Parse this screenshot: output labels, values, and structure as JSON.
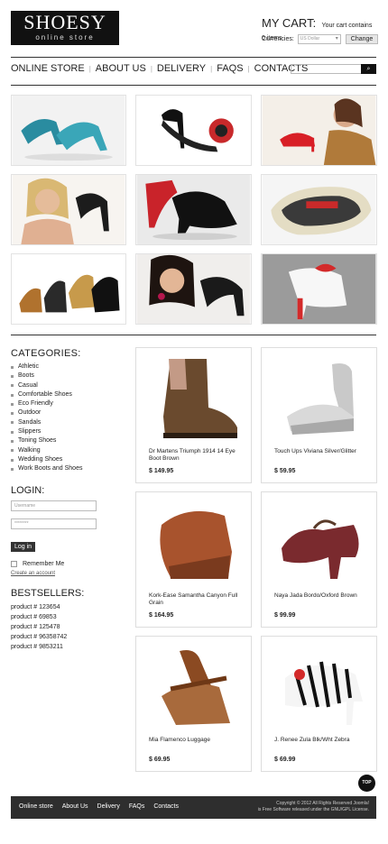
{
  "header": {
    "logo_title": "SHOESY",
    "logo_subtitle": "online store",
    "cart_title": "MY CART:",
    "cart_status": "Your cart contains 0 items",
    "currencies_label": "Currencies:",
    "currency_selected": "US Dollar",
    "change_button": "Change"
  },
  "nav": {
    "items": [
      "ONLINE STORE",
      "ABOUT US",
      "DELIVERY",
      "FAQS",
      "CONTACTS"
    ],
    "search_button": "Go"
  },
  "gallery": [
    {
      "icon": "teal-heels-photo"
    },
    {
      "icon": "black-red-sandal-photo"
    },
    {
      "icon": "woman-red-shoe-photo"
    },
    {
      "icon": "blonde-woman-shoe-photo"
    },
    {
      "icon": "black-peep-toe-photo"
    },
    {
      "icon": "sneaker-sole-photo"
    },
    {
      "icon": "sandals-collection-photo"
    },
    {
      "icon": "woman-studded-heel-photo"
    },
    {
      "icon": "white-red-heel-photo"
    }
  ],
  "sidebar": {
    "categories_title": "CATEGORIES:",
    "categories": [
      "Athletic",
      "Boots",
      "Casual",
      "Comfortable Shoes",
      "Eco Friendly",
      "Outdoor",
      "Sandals",
      "Slippers",
      "Toning Shoes",
      "Walking",
      "Wedding Shoes",
      "Work Boots and Shoes"
    ],
    "login_title": "LOGIN:",
    "username_placeholder": "Username",
    "password_placeholder": "********",
    "login_button": "Log in",
    "remember_label": "Remember Me",
    "create_account": "Create an account",
    "bestsellers_title": "BESTSELLERS:",
    "bestsellers": [
      "product # 123654",
      "product # 69853",
      "product # 125478",
      "product # 96358742",
      "product # 9853211"
    ]
  },
  "products": [
    {
      "name": "Dr Martens Triumph 1914 14 Eye Boot Brown",
      "price": "$ 149.95"
    },
    {
      "name": "Touch Ups Viviana Silver/Glitter",
      "price": "$ 59.95"
    },
    {
      "name": "Kork-Ease Samantha Canyon Full Grain",
      "price": "$ 164.95"
    },
    {
      "name": "Naya Jada Bordo/Oxford Brown",
      "price": "$ 99.99"
    },
    {
      "name": "Mia Flamenco Luggage",
      "price": "$ 69.95"
    },
    {
      "name": "J. Renee Zula Blk/Wht Zebra",
      "price": "$ 69.99"
    }
  ],
  "footer": {
    "links": [
      "Online store",
      "About Us",
      "Delivery",
      "FAQs",
      "Contacts"
    ],
    "copyright_line1": "Copyright © 2012 All Rights Reserved Joomla!",
    "copyright_line2": "is Free Software released under the GNU/GPL License.",
    "top_button": "TOP"
  }
}
